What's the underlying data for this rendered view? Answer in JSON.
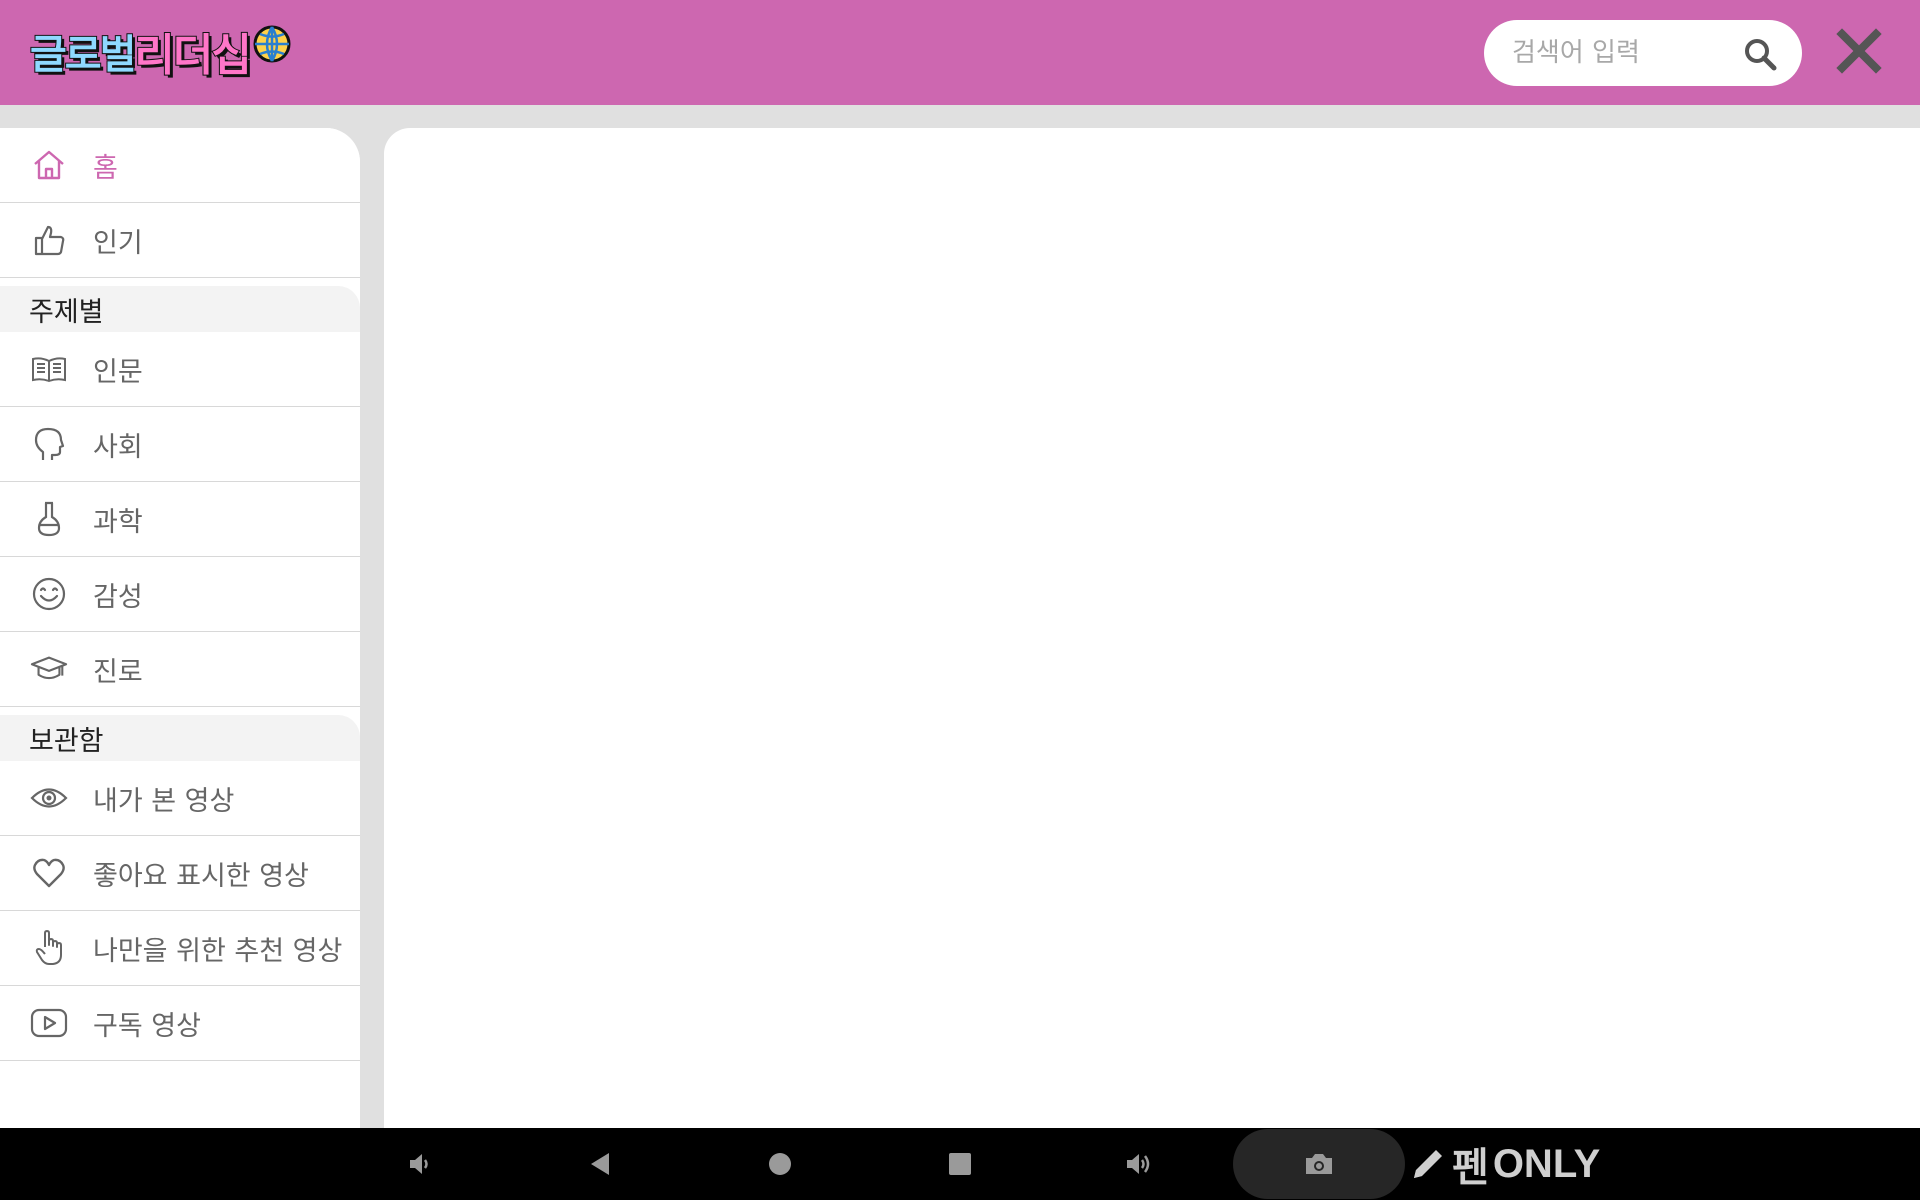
{
  "header": {
    "logo_text_part1": "글로벌",
    "logo_text_part2": "리더십",
    "search_placeholder": "검색어 입력",
    "bg_color": "#cd67b0"
  },
  "sidebar": {
    "items_top": [
      {
        "label": "홈",
        "icon": "home-icon",
        "active": true
      },
      {
        "label": "인기",
        "icon": "thumbs-up-icon",
        "active": false
      }
    ],
    "section_topics": {
      "title": "주제별",
      "items": [
        {
          "label": "인문",
          "icon": "book-icon"
        },
        {
          "label": "사회",
          "icon": "head-icon"
        },
        {
          "label": "과학",
          "icon": "flask-icon"
        },
        {
          "label": "감성",
          "icon": "smile-icon"
        },
        {
          "label": "진로",
          "icon": "graduation-cap-icon"
        }
      ]
    },
    "section_library": {
      "title": "보관함",
      "items": [
        {
          "label": "내가 본 영상",
          "icon": "eye-icon"
        },
        {
          "label": "좋아요 표시한 영상",
          "icon": "heart-icon"
        },
        {
          "label": "나만을 위한 추천 영상",
          "icon": "pointing-hand-icon"
        },
        {
          "label": "구독 영상",
          "icon": "play-icon"
        }
      ]
    }
  },
  "system_bar": {
    "pen_only_word1": "펜",
    "pen_only_word2": "ONLY"
  }
}
